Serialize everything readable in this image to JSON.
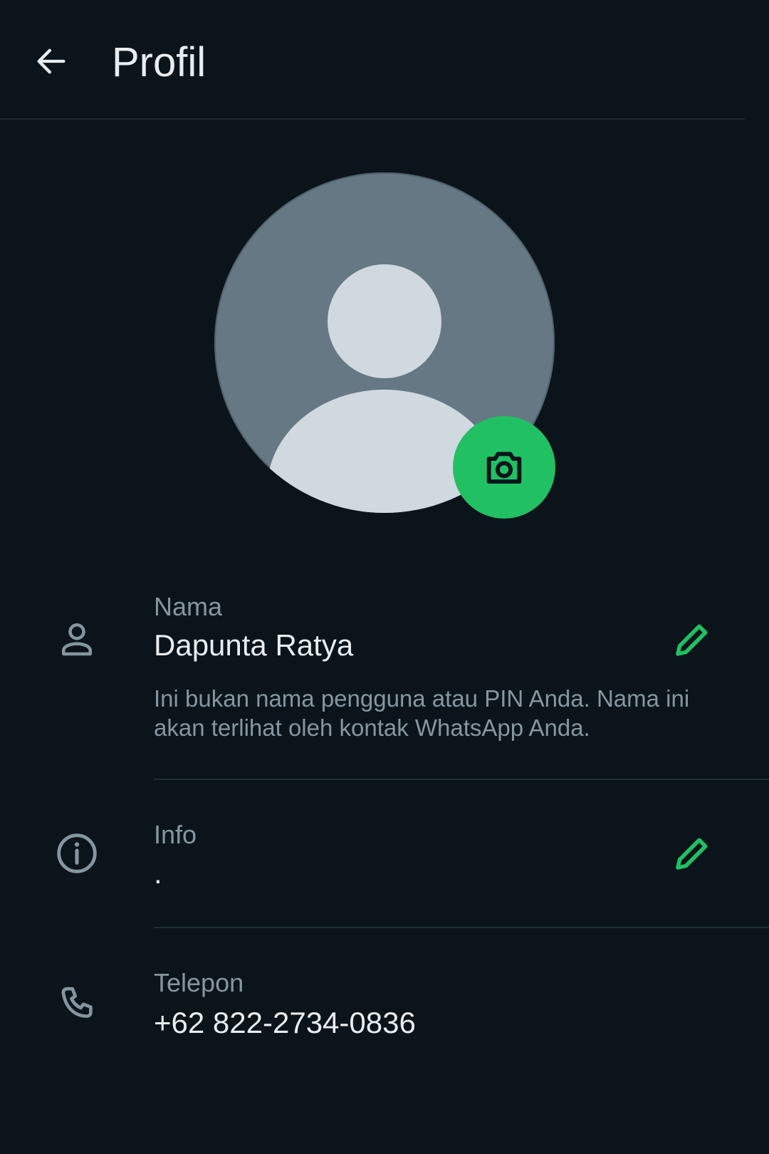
{
  "header": {
    "title": "Profil",
    "back_icon": "arrow-left-icon"
  },
  "avatar": {
    "placeholder_icon": "default-person-avatar",
    "camera_icon": "camera-icon",
    "accent_color": "#21c063"
  },
  "fields": {
    "name": {
      "icon": "person-icon",
      "label": "Nama",
      "value": "Dapunta Ratya",
      "hint": "Ini bukan nama pengguna atau PIN Anda. Nama ini akan terlihat oleh kontak WhatsApp Anda.",
      "edit_icon": "pencil-icon"
    },
    "about": {
      "icon": "info-icon",
      "label": "Info",
      "value": ".",
      "edit_icon": "pencil-icon"
    },
    "phone": {
      "icon": "phone-icon",
      "label": "Telepon",
      "value": "+62 822-2734-0836"
    }
  },
  "colors": {
    "background": "#0b141b",
    "primary_text": "#e9edef",
    "secondary_text": "#8696a0",
    "accent": "#21c063"
  }
}
